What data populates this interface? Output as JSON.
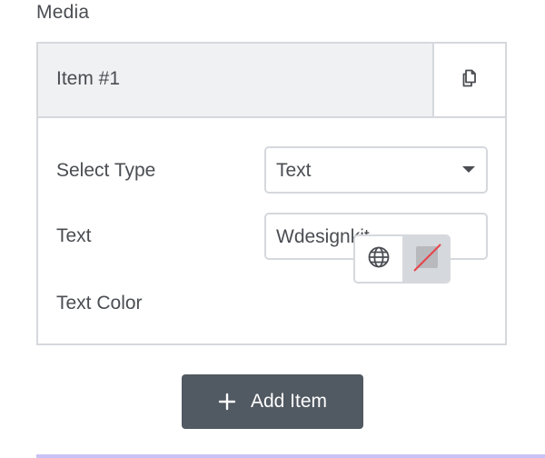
{
  "section": {
    "title": "Media"
  },
  "item": {
    "title": "Item #1",
    "duplicate_icon": "copy-icon"
  },
  "fields": {
    "select_type": {
      "label": "Select Type",
      "value": "Text"
    },
    "text": {
      "label": "Text",
      "value": "Wdesignkit"
    },
    "text_color": {
      "label": "Text Color",
      "global_icon": "globe-icon",
      "swatch": "none"
    }
  },
  "add_item": {
    "label": "Add Item",
    "icon": "plus-icon"
  },
  "colors": {
    "button_bg": "#515962",
    "border": "#d5d8dc",
    "header_bg": "#f0f1f3",
    "accent_line": "#c8c2f5",
    "swatch_slash": "#e8434b"
  }
}
